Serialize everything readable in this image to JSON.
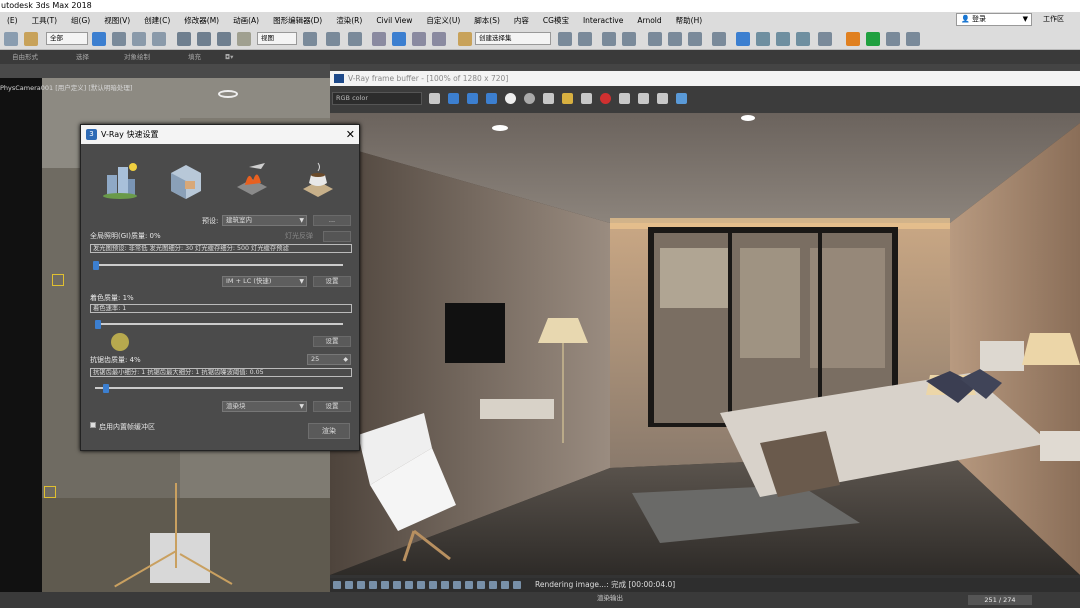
{
  "app": {
    "title": "utodesk 3ds Max 2018"
  },
  "menu": {
    "items": [
      "(E)",
      "工具(T)",
      "组(G)",
      "视图(V)",
      "创建(C)",
      "修改器(M)",
      "动画(A)",
      "图形编辑器(D)",
      "渲染(R)",
      "Civil View",
      "自定义(U)",
      "脚本(S)",
      "内容",
      "CG模宝",
      "Interactive",
      "Arnold",
      "帮助(H)"
    ],
    "login": "登录",
    "workspace": "工作区"
  },
  "toolbar": {
    "selection_filter": "全部",
    "ref_coord": "视图",
    "named_selection": "创建选择集"
  },
  "ribbon": {
    "items": [
      "自由形式",
      "选择",
      "对象绘制",
      "填充"
    ]
  },
  "viewport": {
    "label": "PhysCamera001 [用户定义] [默认明暗处理]"
  },
  "vray_quick": {
    "title": "V-Ray 快速设置",
    "preset_label": "预设:",
    "preset_value": "建筑室内",
    "gi_quality_label": "全局照明(GI)质量: 0%",
    "light_bounce_label": "灯光反弹",
    "gi_field": "发光图预设: 非常低  发光图细分: 30  灯光缓存细分: 500  灯光缓存预滤",
    "gi_engine": "IM + LC (快速)",
    "settings_label": "设置",
    "shading_label": "着色质量: 1%",
    "shading_field": "着色速率: 1",
    "aa_label": "抗锯齿质量: 4%",
    "aa_spin": "25",
    "aa_field": "抗锯齿最小细分: 1   抗锯齿最大细分: 1   抗锯齿噪波阈值: 0.05",
    "aa_mode": "渲染块",
    "vfb_checkbox": "启用内置帧缓冲区",
    "render_button": "渲染",
    "gi_slider": 0.0,
    "shading_slider": 0.01,
    "aa_slider": 0.04
  },
  "vfb": {
    "title": "V-Ray frame buffer - [100% of 1280 x 720]",
    "channel": "RGB color",
    "status": "Rendering image...: 完成 [00:00:04.0]"
  },
  "status": {
    "render_output": "渲染输出",
    "coords": "251 / 274"
  },
  "colors": {
    "accent_blue": "#3c7fd0",
    "vray_panel": "#4b4b4b",
    "knob": "#3c7fd0"
  }
}
